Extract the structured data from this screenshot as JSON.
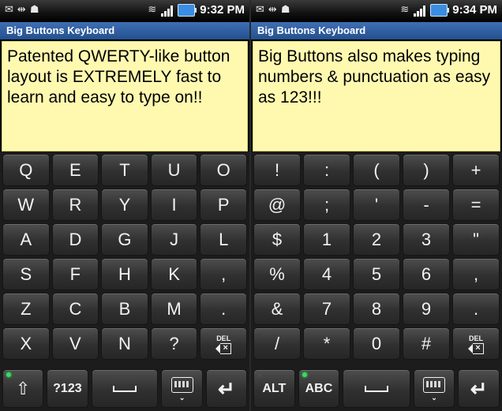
{
  "left": {
    "status": {
      "time": "9:32 PM"
    },
    "title": "Big Buttons Keyboard",
    "text": "Patented QWERTY-like button layout is EXTREMELY fast to learn and easy to type on!!",
    "keys": [
      [
        "Q",
        "E",
        "T",
        "U",
        "O"
      ],
      [
        "W",
        "R",
        "Y",
        "I",
        "P"
      ],
      [
        "A",
        "D",
        "G",
        "J",
        "L"
      ],
      [
        "S",
        "F",
        "H",
        "K",
        ","
      ],
      [
        "Z",
        "C",
        "B",
        "M",
        "."
      ],
      [
        "X",
        "V",
        "N",
        "?",
        "DEL"
      ]
    ],
    "bottom": {
      "key1": "⇧",
      "key2": "?123"
    }
  },
  "right": {
    "status": {
      "time": "9:34 PM"
    },
    "title": "Big Buttons Keyboard",
    "text": "Big Buttons also makes typing numbers & punctuation as easy as 123!!!",
    "keys": [
      [
        "!",
        ":",
        "(",
        ")",
        "+"
      ],
      [
        "@",
        ";",
        "'",
        "-",
        "="
      ],
      [
        "$",
        "1",
        "2",
        "3",
        "\""
      ],
      [
        "%",
        "4",
        "5",
        "6",
        ","
      ],
      [
        "&",
        "7",
        "8",
        "9",
        "."
      ],
      [
        "/",
        "*",
        "0",
        "#",
        "DEL"
      ]
    ],
    "bottom": {
      "key1": "ALT",
      "key2": "ABC"
    }
  },
  "colors": {
    "text_area_bg": "#fff9b0",
    "title_bar": "#2f5e9f",
    "led_green": "#2ee05a"
  },
  "icons": {
    "status_left": [
      "email-icon",
      "usb-icon",
      "android-debug-icon"
    ],
    "status_right": [
      "wifi-icon",
      "signal-icon",
      "battery-icon"
    ],
    "delete": "backspace-icon",
    "space": "space-icon",
    "keyboard": "keyboard-hide-icon",
    "enter": "enter-icon"
  }
}
